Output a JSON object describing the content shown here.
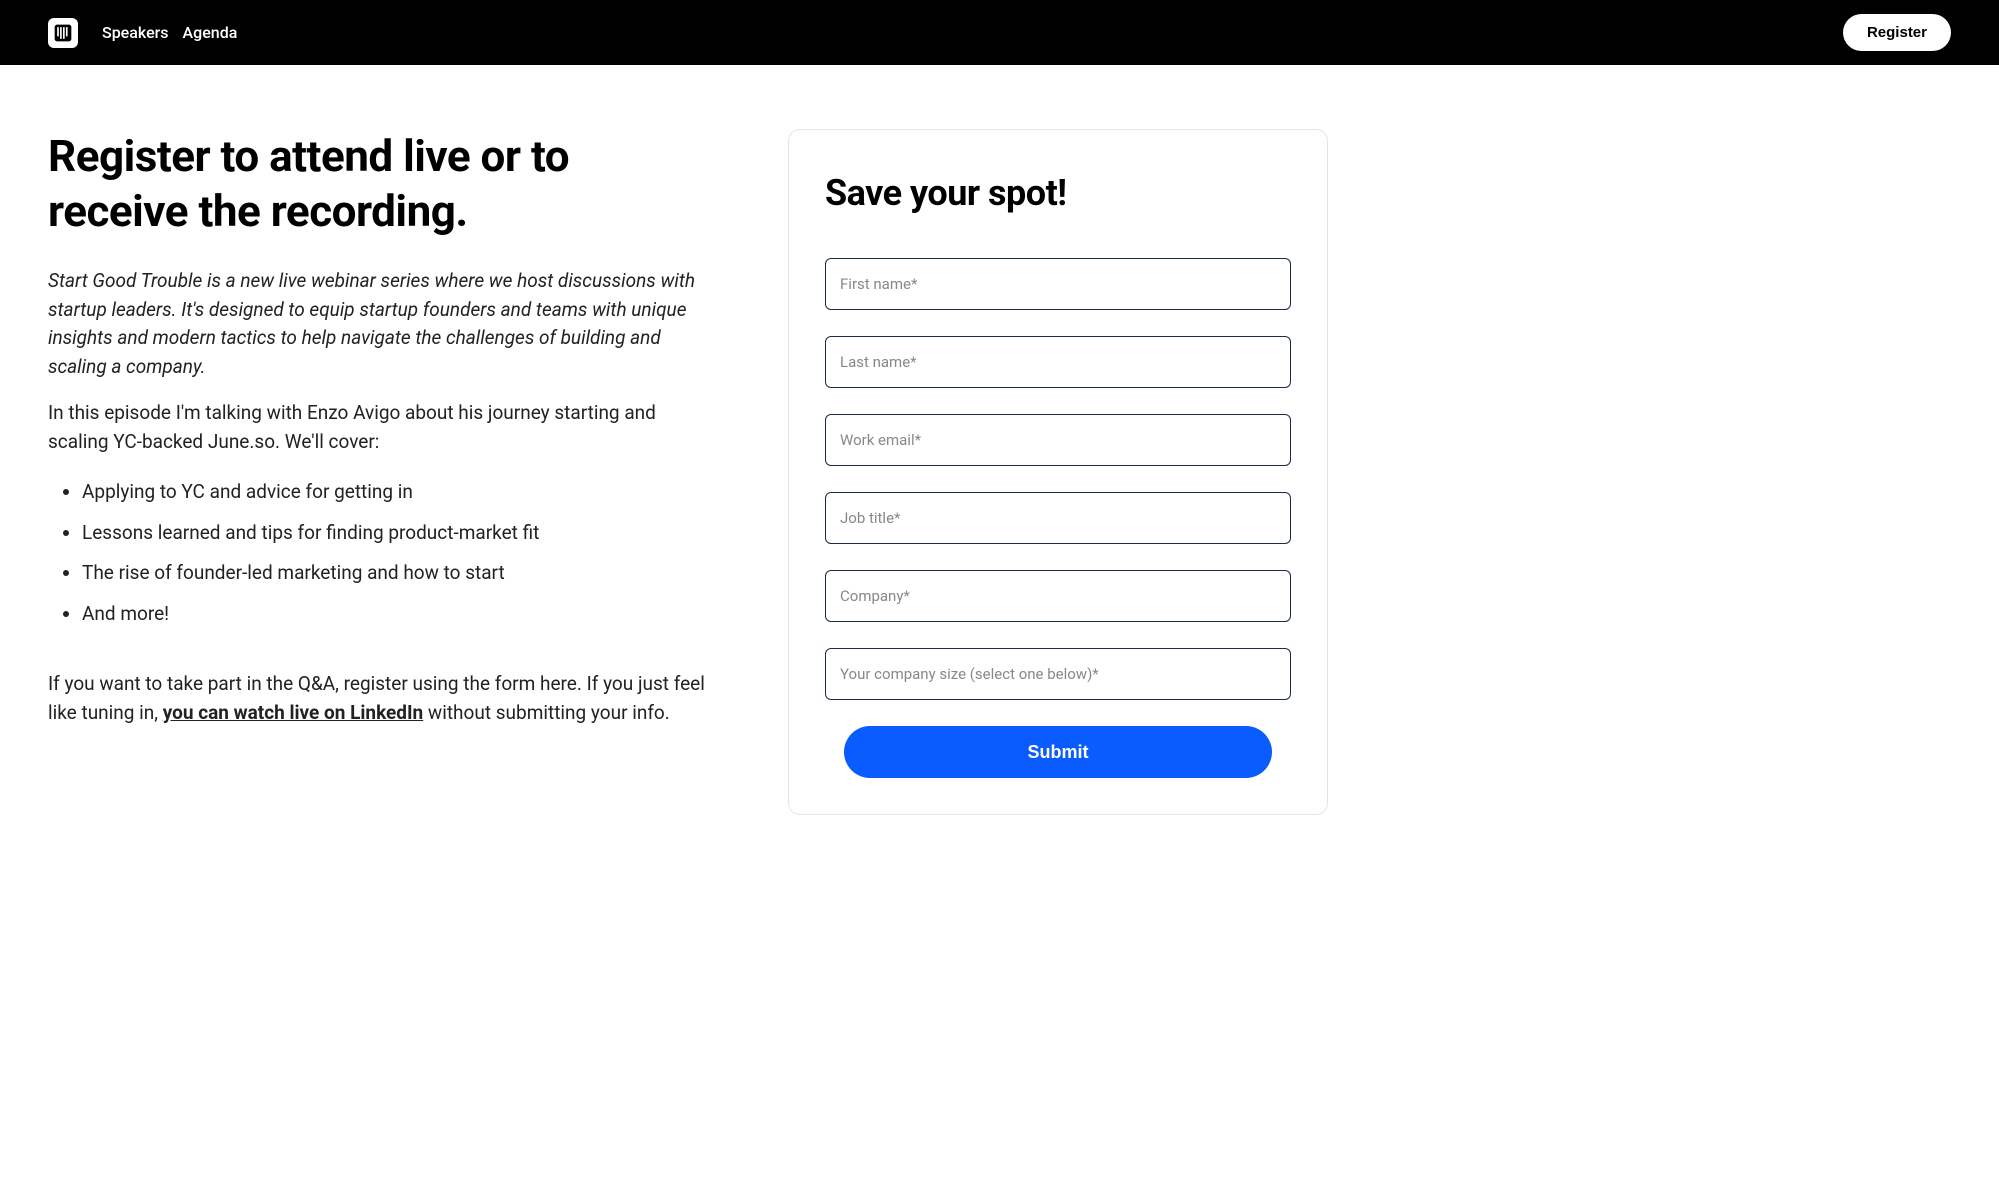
{
  "header": {
    "nav": {
      "speakers": "Speakers",
      "agenda": "Agenda"
    },
    "register": "Register"
  },
  "content": {
    "title": "Register to attend live or to receive the recording.",
    "intro": "Start Good Trouble is a new live webinar series where we host discussions with startup leaders. It's designed to equip startup founders and teams with unique insights and modern tactics to help navigate the challenges of building and scaling a company.",
    "episode_text": "In this episode I'm talking with Enzo Avigo about his journey starting and scaling YC-backed June.so. We'll cover:",
    "bullets": [
      "Applying to YC and advice for getting in",
      "Lessons learned and tips for finding product-market fit",
      "The rise of founder-led marketing and how to start",
      "And more!"
    ],
    "closing_pre": "If you want to take part in the Q&A, register using the form here. If you just feel like tuning in, ",
    "closing_link": "you can watch live on LinkedIn",
    "closing_post": " without submitting your info."
  },
  "form": {
    "title": "Save your spot!",
    "fields": {
      "first_name": "First name*",
      "last_name": "Last name*",
      "work_email": "Work email*",
      "job_title": "Job title*",
      "company": "Company*",
      "company_size": "Your company size (select one below)*"
    },
    "submit": "Submit"
  }
}
